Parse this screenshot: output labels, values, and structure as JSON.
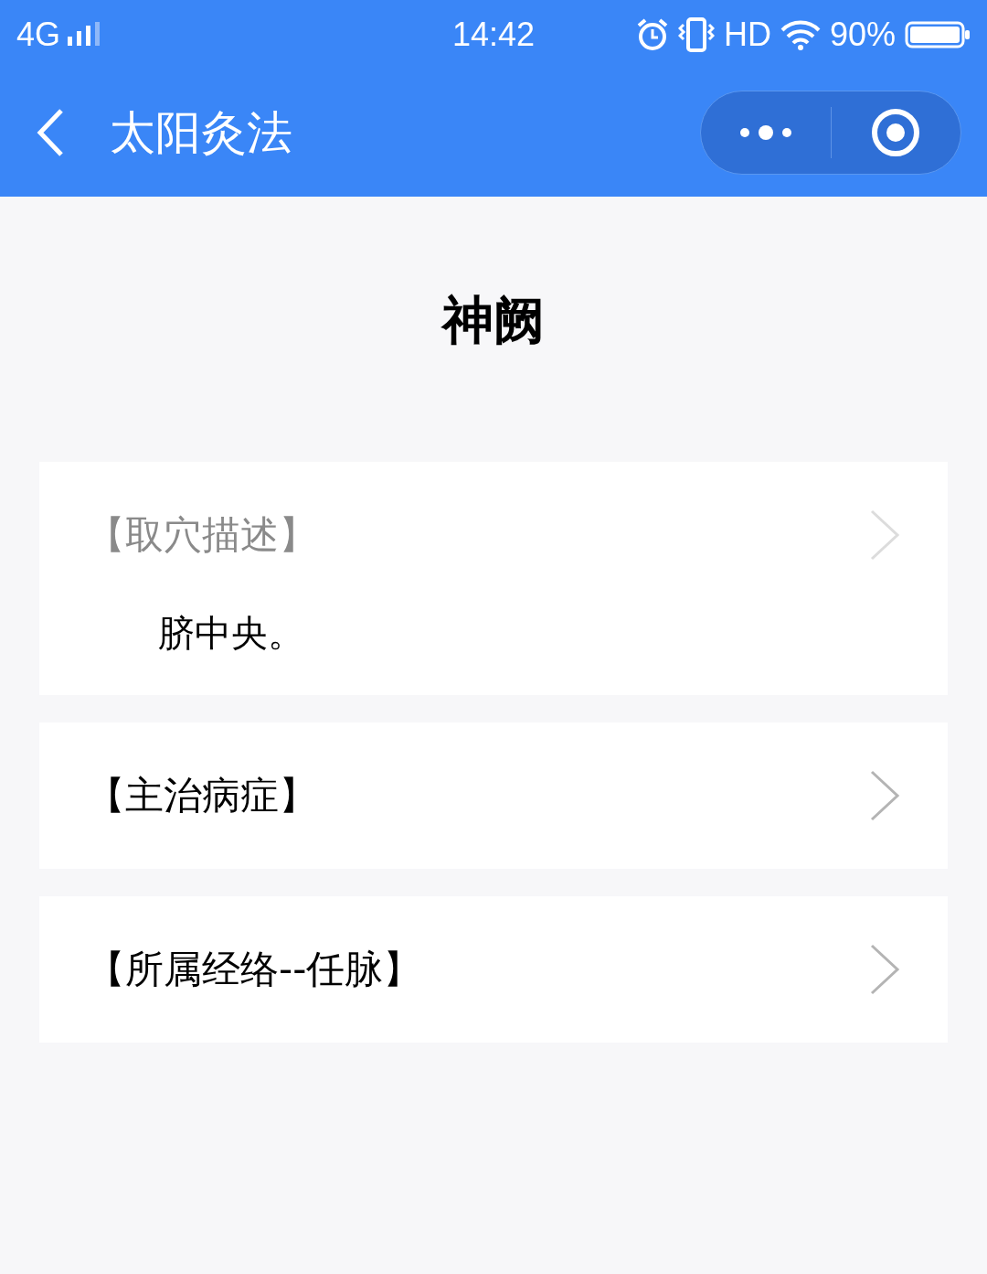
{
  "status_bar": {
    "network": "4G",
    "time": "14:42",
    "hd": "HD",
    "battery": "90%"
  },
  "nav_bar": {
    "title": "太阳灸法"
  },
  "page": {
    "title": "神阙",
    "sections": [
      {
        "heading": "【取穴描述】",
        "expanded": true,
        "body": "脐中央。"
      },
      {
        "heading": "【主治病症】",
        "expanded": false
      },
      {
        "heading": "【所属经络--任脉】",
        "expanded": false
      }
    ]
  }
}
